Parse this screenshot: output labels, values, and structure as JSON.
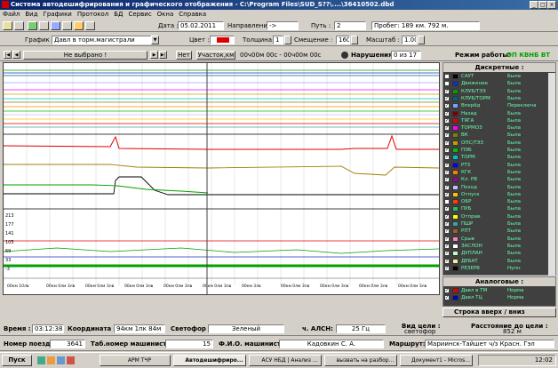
{
  "window": {
    "title": "Система автодешифрирования и графического отображения - C:\\Program Files\\SUD_S??\\....\\36410502.dbd"
  },
  "menu": [
    "Файл",
    "Вид",
    "Графики",
    "Протокол",
    "БД",
    "Сервис",
    "Окна",
    "Справка"
  ],
  "info": {
    "date_label": "Дата :",
    "date": "05.02.2011",
    "dir_label": "Направление :",
    "dir": "->",
    "path_label": "Путь :",
    "path": "2",
    "run_label": "Пробег: 189 км. 792 м."
  },
  "tb2": {
    "graph_label": "График :",
    "graph": "Давл в торм.магистрали",
    "color_label": "Цвет :",
    "thick_label": "Толщина :",
    "thick": "1",
    "offset_label": "Смещение :",
    "offset": "160",
    "scale_label": "Масштаб :",
    "scale": "1.00"
  },
  "tb3": {
    "nav": "Не выбрано !",
    "no": "Нет",
    "section": "Участок,км",
    "range": "00ч00м 00с - 00ч00м 00с",
    "viol_label": "Нарушения:",
    "viol": "0 из 17",
    "mode_label": "Режим работы:",
    "mode": "ОП КВНБ ВТ"
  },
  "scale_ticks": [
    "213",
    "177",
    "141",
    "105",
    "69",
    "33",
    "-3"
  ],
  "time_ticks": [
    "00км 10лв",
    "00км 0лм 3лв",
    "00км 0лм 3лв",
    "00км 0лм 3лв",
    "00км 0лм 3лв",
    "00км 0лм 3лв",
    "00км 3лв",
    "00км 0лм 3лв",
    "00км 0лм 3лв",
    "00км 0лм 3лв",
    "00км 0лм 3лв"
  ],
  "discrete": {
    "title": "Дискретные :",
    "items": [
      {
        "name": "САУТ",
        "val": "Была",
        "color": "#000000",
        "on": false
      },
      {
        "name": "Движение",
        "val": "Была",
        "color": "#1030c0",
        "on": false
      },
      {
        "name": "КЛУБ/ТЭЗ",
        "val": "Была",
        "color": "#00a000",
        "on": true
      },
      {
        "name": "КЛУБ/ТОРМ",
        "val": "Была",
        "color": "#006080",
        "on": true
      },
      {
        "name": "Вперёд",
        "val": "Переключа",
        "color": "#80a0ff",
        "on": true
      },
      {
        "name": "Назад",
        "val": "Была",
        "color": "#800000",
        "on": true
      },
      {
        "name": "ТЯГА",
        "val": "Была",
        "color": "#e00000",
        "on": true
      },
      {
        "name": "ТОРМОЗ",
        "val": "Была",
        "color": "#ff00ff",
        "on": true
      },
      {
        "name": "ВК",
        "val": "Была",
        "color": "#808000",
        "on": true
      },
      {
        "name": "ОПС/ТЭЗ",
        "val": "Была",
        "color": "#c0a000",
        "on": true
      },
      {
        "name": "ПЭБ",
        "val": "Была",
        "color": "#00c000",
        "on": true
      },
      {
        "name": "ТОРМ",
        "val": "Была",
        "color": "#00c0c0",
        "on": true
      },
      {
        "name": "РТЗ",
        "val": "Была",
        "color": "#0000ff",
        "on": true
      },
      {
        "name": "КГК",
        "val": "Была",
        "color": "#ff8000",
        "on": true
      },
      {
        "name": "Кл. РВ",
        "val": "Была",
        "color": "#a000a0",
        "on": true
      },
      {
        "name": "Поход",
        "val": "Была",
        "color": "#c0c0ff",
        "on": true
      },
      {
        "name": "Отпуск",
        "val": "Была",
        "color": "#ffc000",
        "on": true
      },
      {
        "name": "ОБР",
        "val": "Была",
        "color": "#ff4000",
        "on": false
      },
      {
        "name": "ПУБ",
        "val": "Была",
        "color": "#20c060",
        "on": true
      },
      {
        "name": "Отправ.",
        "val": "Была",
        "color": "#ffff00",
        "on": true
      },
      {
        "name": "ПШР",
        "val": "Была",
        "color": "#40a0a0",
        "on": true
      },
      {
        "name": "РПТ",
        "val": "Была",
        "color": "#a06020",
        "on": true
      },
      {
        "name": "Срыв",
        "val": "Была",
        "color": "#ff80c0",
        "on": true
      },
      {
        "name": "ЗАСЛОН",
        "val": "Была",
        "color": "#ffffff",
        "on": true
      },
      {
        "name": "ДУПЛАН",
        "val": "Была",
        "color": "#c0ffc0",
        "on": true
      },
      {
        "name": "ДЕБАТ",
        "val": "Была",
        "color": "#f0f0a0",
        "on": true
      },
      {
        "name": "РЕЗЕРВ",
        "val": "Нупн",
        "color": "#000000",
        "on": true
      }
    ]
  },
  "analog": {
    "title": "Аналоговые :",
    "items": [
      {
        "name": "Давл в ТМ",
        "val": "Норма",
        "color": "#e00000",
        "on": true
      },
      {
        "name": "Давл ТЦ",
        "val": "Норма",
        "color": "#0000c0",
        "on": true
      }
    ]
  },
  "scroll_btn": "Строка вверх / вниз",
  "bottom1": {
    "time_label": "Время :",
    "time": "03:12:38.0",
    "coord_label": "Координата :",
    "coord": "94км 1пк 84м",
    "light_label": "Светофор :",
    "light": "Зеленый",
    "alsn_label": "ч. АЛСН:",
    "alsn": "25 Гц",
    "target_label": "Вид цели :",
    "target": "светофор",
    "dist_label": "Расстояние до цели :",
    "dist": "852 м"
  },
  "bottom2": {
    "train_label": "Номер поезда:",
    "train": "3641",
    "tab_label": "Таб.номер машиниста:",
    "tab": "15",
    "fio_label": "Ф.И.О. машиниста:",
    "fio": "Кадовкин С. А.",
    "route_label": "Маршрут:",
    "route": "Мариинск-Тайшет ч/з Красн. Гэл"
  },
  "taskbar": {
    "start": "Пуск",
    "tasks": [
      "АРМ ТЧР",
      "Автодешифриро...",
      "АСУ НБД | Анализ ...",
      "вызвать на разбор...",
      "Документ1 - Micros..."
    ],
    "clock": "12:02"
  },
  "chart_data": {
    "type": "line",
    "xlabel": "",
    "ylabel": "",
    "title": "",
    "series": [
      {
        "name": "Давл в ТМ",
        "values": []
      },
      {
        "name": "Давл ТЦ",
        "values": []
      }
    ]
  }
}
